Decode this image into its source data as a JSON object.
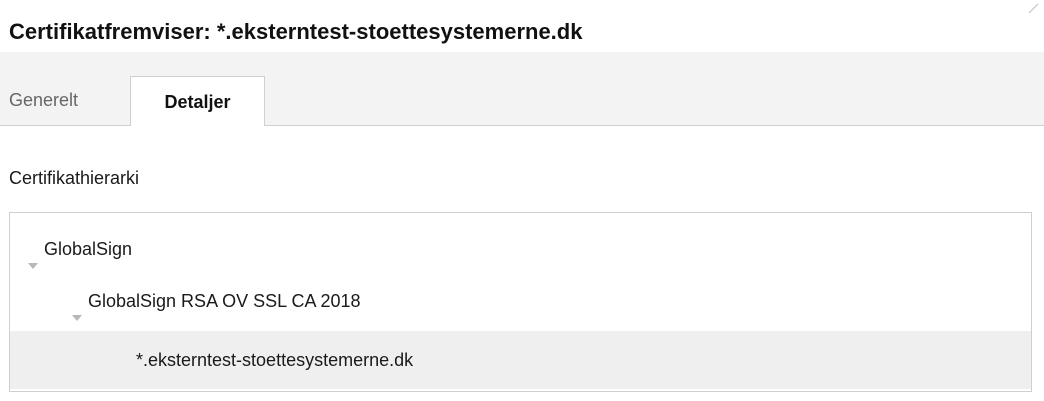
{
  "window": {
    "title": "Certifikatfremviser: *.eksterntest-stoettesystemerne.dk"
  },
  "tabs": [
    {
      "label": "Generelt",
      "selected": false
    },
    {
      "label": "Detaljer",
      "selected": true
    }
  ],
  "details": {
    "hierarchy_label": "Certifikathierarki",
    "tree": [
      {
        "label": "GlobalSign",
        "expanded": true,
        "level": 0,
        "selected": false
      },
      {
        "label": "GlobalSign RSA OV SSL CA 2018",
        "expanded": true,
        "level": 1,
        "selected": false
      },
      {
        "label": "*.eksterntest-stoettesystemerne.dk",
        "expanded": false,
        "level": 2,
        "selected": true
      }
    ]
  },
  "icons": {
    "corner": "resize-grip-icon",
    "twisty": "triangle-down-icon"
  },
  "colors": {
    "tab_strip_bg": "#f3f3f3",
    "selected_row_bg": "#efefef",
    "border": "#cfcfcf",
    "twisty": "#b8b8b8"
  }
}
